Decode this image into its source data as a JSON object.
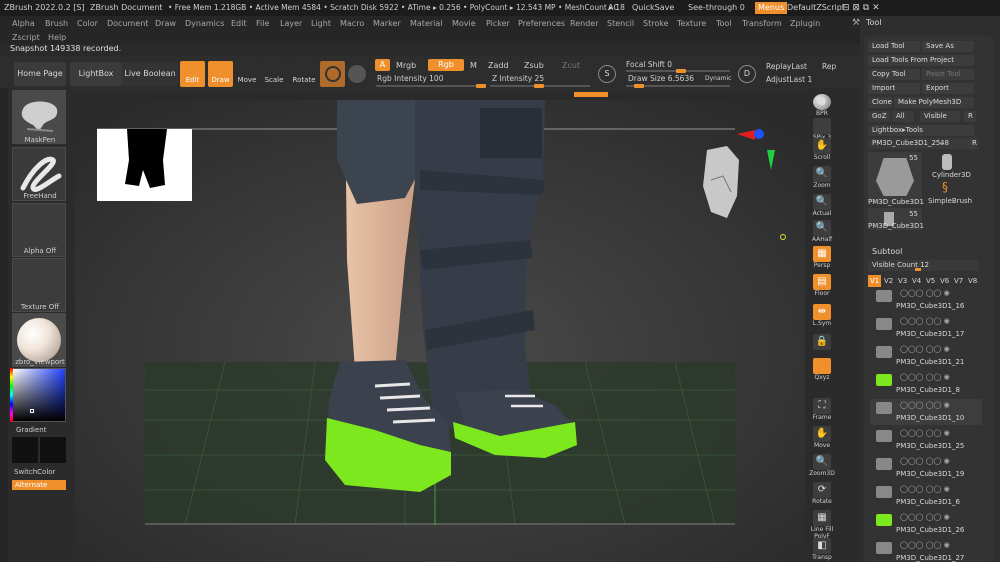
{
  "title": {
    "app": "ZBrush 2022.0.2 [S]",
    "doc": "ZBrush Document",
    "mem": "• Free Mem 1.218GB • Active Mem 4584 • Scratch Disk 5922 • ATime ▸ 0.256 • PolyCount ▸ 12.543 MP • MeshCount ▸ 18",
    "mac": "MAC",
    "ac": "AC",
    "quicksave": "QuickSave",
    "seethrough": "See-through  0",
    "menus": "Menus",
    "script": "DefaultZScript"
  },
  "menu": [
    "Alpha",
    "Brush",
    "Color",
    "Document",
    "Draw",
    "Dynamics",
    "Edit",
    "File",
    "Layer",
    "Light",
    "Macro",
    "Marker",
    "Material",
    "Movie",
    "Picker",
    "Preferences",
    "Render",
    "Stencil",
    "Stroke",
    "Texture",
    "Tool",
    "Transform",
    "Zplugin"
  ],
  "menu2": [
    "Zscript",
    "Help"
  ],
  "notice": "Snapshot 149338 recorded.",
  "shelf": {
    "home": "Home Page",
    "lightbox": "LightBox",
    "liveboolean": "Live Boolean",
    "edit": "Edit",
    "draw": "Draw",
    "move": "Move",
    "scale": "Scale",
    "rotate": "Rotate",
    "a": "A",
    "mrgb": "Mrgb",
    "rgb": "Rgb",
    "m": "M",
    "rgb_intensity": "Rgb Intensity 100",
    "zadd": "Zadd",
    "zsub": "Zsub",
    "zcut": "Zcut",
    "z_intensity": "Z Intensity 25",
    "s_icon": "S",
    "focal_shift": "Focal Shift 0",
    "draw_size": "Draw Size 6.5636",
    "dynamic": "Dynamic",
    "d_icon": "D",
    "replaylast": "ReplayLast",
    "rep": "Rep",
    "adjustlast": "AdjustLast  1"
  },
  "left": {
    "maskpen": "MaskPen",
    "freehand": "FreeHand",
    "alpha_off": "Alpha Off",
    "texture_off": "Texture Off",
    "material": "zbro_Viewport",
    "gradient": "Gradient",
    "switchcolor": "SwitchColor",
    "alternate": "Alternate"
  },
  "right": [
    {
      "n": "bpr",
      "label": "BPR",
      "o": false,
      "ic": "●"
    },
    {
      "n": "spix",
      "label": "SPix 3",
      "o": false,
      "ic": ""
    },
    {
      "n": "scroll",
      "label": "Scroll",
      "o": false,
      "ic": "✋"
    },
    {
      "n": "zoom",
      "label": "Zoom",
      "o": false,
      "ic": "🔍"
    },
    {
      "n": "actual",
      "label": "Actual",
      "o": false,
      "ic": "🔍"
    },
    {
      "n": "aahalf",
      "label": "AAHalf",
      "o": false,
      "ic": "🔍"
    },
    {
      "n": "persp",
      "label": "Persp",
      "o": true,
      "ic": "▦"
    },
    {
      "n": "floor",
      "label": "Floor",
      "o": true,
      "ic": "▤"
    },
    {
      "n": "lsym",
      "label": "L.Sym",
      "o": true,
      "ic": "⇹"
    },
    {
      "n": "lock",
      "label": "",
      "o": false,
      "ic": "🔒"
    },
    {
      "n": "xyz",
      "label": "Qxyz",
      "o": true,
      "ic": ""
    },
    {
      "n": "frame",
      "label": "Frame",
      "o": false,
      "ic": "⛶"
    },
    {
      "n": "move",
      "label": "Move",
      "o": false,
      "ic": "✋"
    },
    {
      "n": "zoom3d",
      "label": "Zoom3D",
      "o": false,
      "ic": "🔍"
    },
    {
      "n": "rotate",
      "label": "Rotate",
      "o": false,
      "ic": "⟳"
    },
    {
      "n": "polyf",
      "label": "Line Fill PolyF",
      "o": false,
      "ic": "▦"
    },
    {
      "n": "transp",
      "label": "Transp",
      "o": false,
      "ic": "◧"
    }
  ],
  "tool": {
    "title": "Tool",
    "load_tool": "Load Tool",
    "save_as": "Save As",
    "load_project": "Load Tools From Project",
    "copy_tool": "Copy Tool",
    "paste_tool": "Paste Tool",
    "import": "Import",
    "export": "Export",
    "clone": "Clone",
    "make_polymesh": "Make PolyMesh3D",
    "goz": "GoZ",
    "all": "All",
    "visible": "Visible",
    "r": "R",
    "lightbox_tools": "Lightbox▸Tools",
    "current_tool": "PM3D_Cube3D1_25.",
    "current_count": "48",
    "thumb1_count": "55",
    "thumb1_label": "PM3D_Cube3D1",
    "cylinder": "Cylinder3D",
    "simplebrush": "SimpleBrush",
    "thumb2_count": "55",
    "thumb2_label": "PM3D_Cube3D1"
  },
  "subtool": {
    "title": "Subtool",
    "visible_count": "Visible Count 12",
    "versions": [
      "V1",
      "V2",
      "V3",
      "V4",
      "V5",
      "V6",
      "V7",
      "V8"
    ],
    "items": [
      "PM3D_Cube3D1_16",
      "PM3D_Cube3D1_17",
      "PM3D_Cube3D1_21",
      "PM3D_Cube3D1_8",
      "PM3D_Cube3D1_10",
      "PM3D_Cube3D1_25",
      "PM3D_Cube3D1_19",
      "PM3D_Cube3D1_6",
      "PM3D_Cube3D1_26",
      "PM3D_Cube3D1_27"
    ]
  },
  "colors": {
    "accent": "#f0902c",
    "shoe_sole": "#7ee81e",
    "shoe_upper": "#3a3f4c",
    "pants": "#3c4450"
  }
}
